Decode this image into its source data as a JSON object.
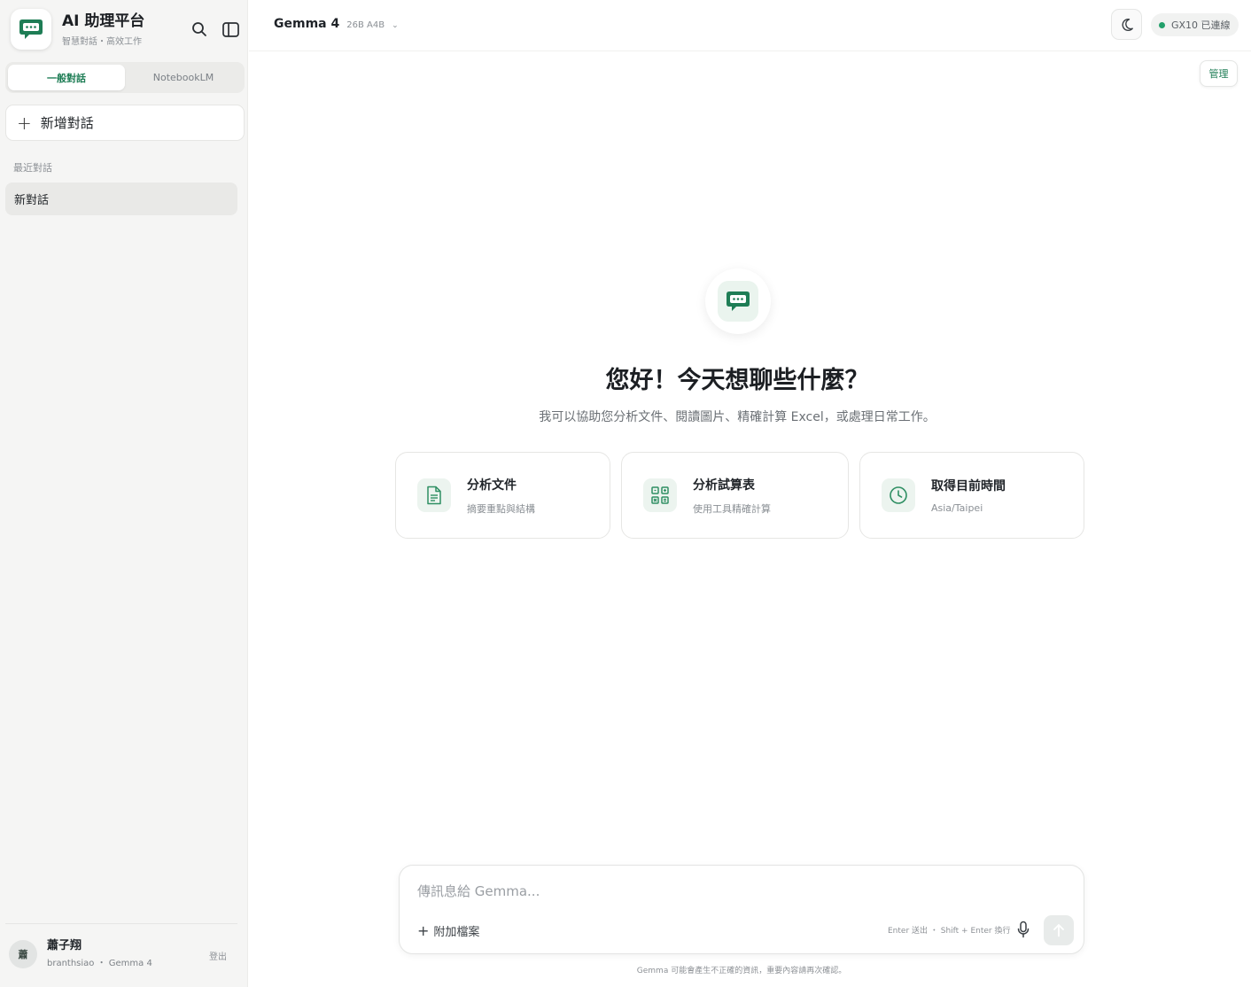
{
  "sidebar": {
    "brand_title": "AI 助理平台",
    "brand_subtitle": "智慧對話・高效工作",
    "tabs": [
      {
        "label": "一般對話",
        "active": true
      },
      {
        "label": "NotebookLM",
        "active": false
      }
    ],
    "new_chat_label": "新增對話",
    "recent_label": "最近對話",
    "conversations": [
      {
        "title": "新對話"
      }
    ],
    "user": {
      "avatar_text": "蕭",
      "name": "蕭子翔",
      "meta": "branthsiao ・ Gemma 4",
      "logout_label": "登出"
    }
  },
  "header": {
    "model_name": "Gemma 4",
    "model_variant": "26B A4B",
    "model_caret": "⌄",
    "status_text": "GX10 已連線",
    "status_color": "#22a06b",
    "manage_label": "管理"
  },
  "welcome": {
    "title": "您好！今天想聊些什麼？",
    "subtitle": "我可以協助您分析文件、閱讀圖片、精確計算 Excel，或處理日常工作。",
    "cards": [
      {
        "icon": "document-icon",
        "title": "分析文件",
        "subtitle": "摘要重點與結構"
      },
      {
        "icon": "spreadsheet-icon",
        "title": "分析試算表",
        "subtitle": "使用工具精確計算"
      },
      {
        "icon": "clock-icon",
        "title": "取得目前時間",
        "subtitle": "Asia/Taipei"
      }
    ]
  },
  "composer": {
    "placeholder": "傳訊息給 Gemma...",
    "attach_label": "附加檔案",
    "hint": "Enter 送出 ・ Shift + Enter 換行",
    "disclaimer": "Gemma 可能會產生不正確的資訊，重要內容請再次確認。"
  },
  "colors": {
    "accent": "#1e7d55",
    "accent_light": "#ecf4ef"
  }
}
